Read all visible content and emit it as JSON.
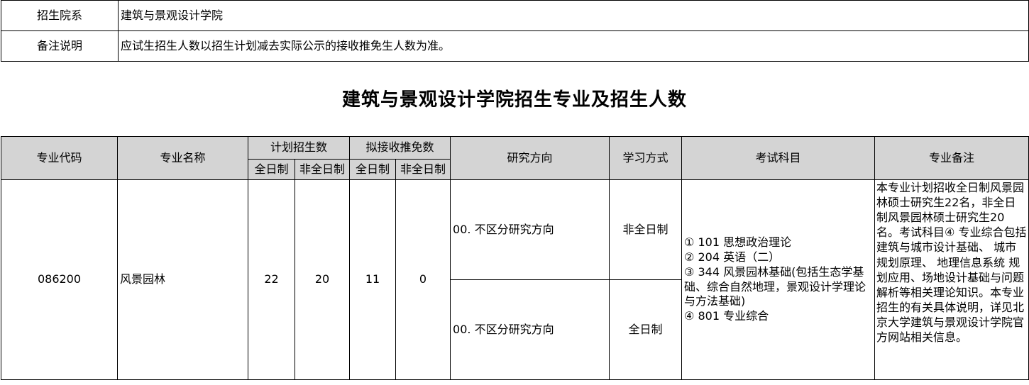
{
  "info": {
    "rows": [
      {
        "label": "招生院系",
        "value": "建筑与景观设计学院"
      },
      {
        "label": "备注说明",
        "value": "应试生招生人数以招生计划减去实际公示的接收推免生人数为准。"
      }
    ]
  },
  "page_title": "建筑与景观设计学院招生专业及招生人数",
  "table": {
    "headers": {
      "code": "专业代码",
      "name": "专业名称",
      "plan": "计划招生数",
      "recommend": "拟接收推免数",
      "plan_full": "全日制",
      "plan_part": "非全日制",
      "rec_full": "全日制",
      "rec_part": "非全日制",
      "direction": "研究方向",
      "mode": "学习方式",
      "subjects": "考试科目",
      "note": "专业备注"
    },
    "row": {
      "code": "086200",
      "name": "风景园林",
      "plan_full": "22",
      "plan_part": "20",
      "rec_full": "11",
      "rec_part": "0",
      "directions": [
        {
          "direction": "00. 不区分研究方向",
          "mode": "非全日制"
        },
        {
          "direction": "00. 不区分研究方向",
          "mode": "全日制"
        }
      ],
      "subjects": [
        "① 101 思想政治理论",
        "② 204 英语（二）",
        "③ 344 风景园林基础(包括生态学基础、综合自然地理，景观设计学理论与方法基础)",
        "④ 801 专业综合"
      ],
      "note": "本专业计划招收全日制风景园林硕士研究生22名，非全日制风景园林硕士研究生20名。考试科目④ 专业综合包括建筑与城市设计基础、 城市规划原理、 地理信息系统 规划应用、场地设计基础与问题解析等相关理论知识。本专业招生的有关具体说明，详见北京大学建筑与景观设计学院官方网站相关信息。"
    }
  }
}
